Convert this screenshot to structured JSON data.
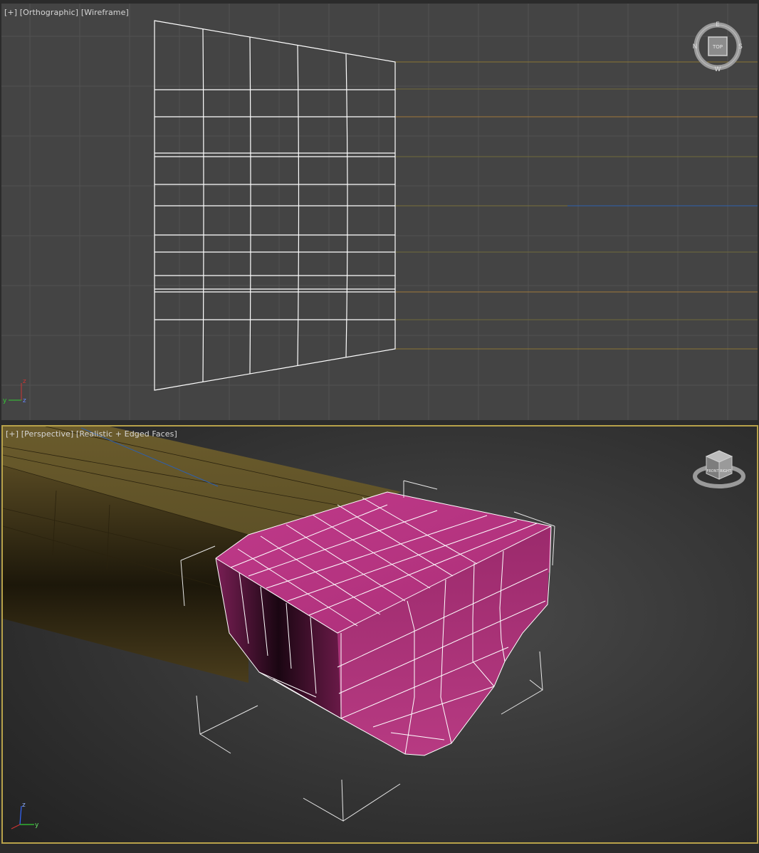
{
  "viewports": {
    "top": {
      "label_plus": "[+]",
      "label_view": "[Orthographic]",
      "label_shading": "[Wireframe]",
      "compass": {
        "n": "N",
        "e": "E",
        "s": "S",
        "w": "W",
        "cube_face": "TOP"
      },
      "axis": {
        "x": "x",
        "y": "y",
        "z": "z"
      }
    },
    "perspective": {
      "label_plus": "[+]",
      "label_view": "[Perspective]",
      "label_shading": "[Realistic + Edged Faces]",
      "viewcube": {
        "face_left": "FRONT",
        "face_right": "RIGHT"
      },
      "axis": {
        "x": "x",
        "y": "y",
        "z": "z"
      }
    }
  },
  "colors": {
    "ortho_bg": "#444444",
    "grid": "#525252",
    "wire": "#ffffff",
    "selection_border": "#b8a24a",
    "handle": "#b08c3a",
    "selected_mesh": "#b0307a",
    "axis_x": "#cc3333",
    "axis_y": "#33cc33",
    "axis_z": "#3366ff"
  }
}
